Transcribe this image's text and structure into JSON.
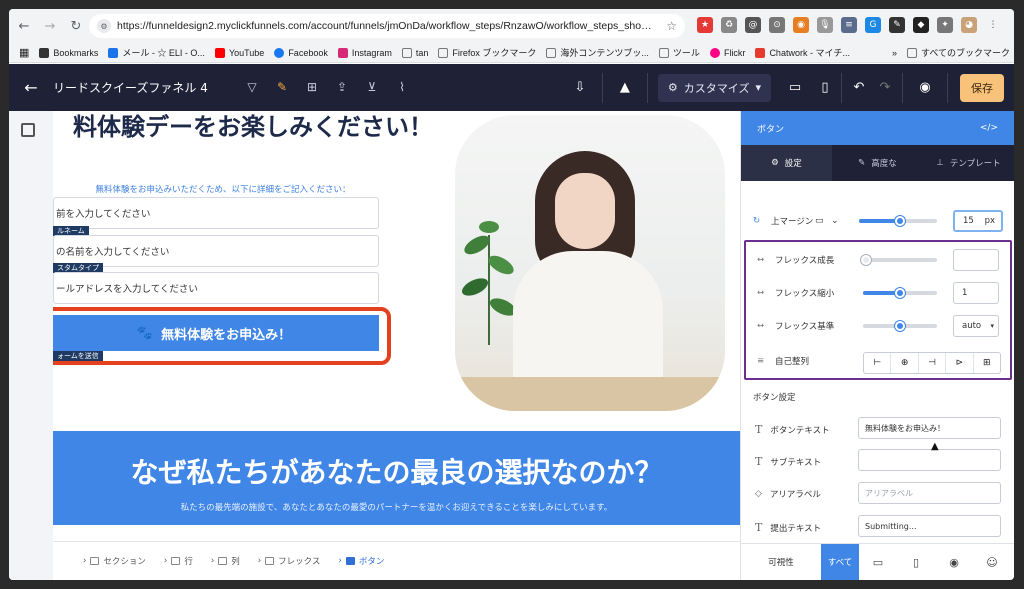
{
  "browser": {
    "url": "https://funneldesign2.myclickfunnels.com/account/funnels/jmOnDa/workflow_steps/RnzawO/workflow_steps_show_pa...",
    "bookmarks": [
      {
        "label": "Bookmarks",
        "color": "#333333"
      },
      {
        "label": "メール - ☆ ELI - O...",
        "color": "#1a73e8"
      },
      {
        "label": "YouTube",
        "color": "#ff0000"
      },
      {
        "label": "Facebook",
        "color": "#1877f2"
      },
      {
        "label": "Instagram",
        "color": "#d62976"
      },
      {
        "label": "tan",
        "color": "#777777"
      },
      {
        "label": "Firefox ブックマーク",
        "color": "#777777"
      },
      {
        "label": "海外コンテンツブッ...",
        "color": "#777777"
      },
      {
        "label": "ツール",
        "color": "#777777"
      },
      {
        "label": "Flickr",
        "color": "#ff0084"
      },
      {
        "label": "Chatwork - マイチ...",
        "color": "#e63a2e"
      }
    ],
    "bookmarks_more": "»",
    "all_bookmarks": "すべてのブックマーク"
  },
  "appbar": {
    "funnel_name": "リードスクイーズファネル 4",
    "customize_label": "カスタマイズ",
    "save_label": "保存"
  },
  "canvas": {
    "headline": "料体験デーをお楽しみください！",
    "subtext": "無料体験をお申込みいただくため、以下に詳細をご記入ください：",
    "fields": [
      {
        "text": "前を入力してください",
        "tag": "ルネーム"
      },
      {
        "text": "の名前を入力してください",
        "tag": "スタムタイプ"
      },
      {
        "text": "ールアドレスを入力してください",
        "tag": ""
      }
    ],
    "submit_label": "無料体験をお申込み！",
    "submit_tag": "ォームを送信",
    "banner_title": "なぜ私たちがあなたの最良の選択なのか？",
    "banner_sub": "私たちの最先端の施設で、あなたとあなたの最愛のパートナーを温かくお迎えできることを楽しみにしています。"
  },
  "breadcrumbs": [
    "セクション",
    "行",
    "列",
    "フレックス",
    "ボタン"
  ],
  "panel": {
    "title": "ボタン",
    "code_icon": "</>",
    "tabs": [
      "設定",
      "高度な",
      "テンプレート"
    ],
    "top_margin_label": "上マージン",
    "top_margin_value": "15",
    "top_margin_unit": "px",
    "flex_grow_label": "フレックス成長",
    "flex_shrink_label": "フレックス縮小",
    "flex_shrink_value": "1",
    "flex_basis_label": "フレックス基準",
    "flex_basis_value": "auto",
    "self_align_label": "自己整列",
    "button_settings_title": "ボタン設定",
    "button_text_label": "ボタンテキスト",
    "button_text_value": "無料体験をお申込み！",
    "subtext_label": "サブテキスト",
    "subtext_value": "",
    "aria_label": "アリアラベル",
    "aria_placeholder": "アリアラベル",
    "submit_text_label": "提出テキスト",
    "submit_text_value": "Submitting...",
    "visibility_label": "可視性",
    "visibility_all": "すべて"
  }
}
